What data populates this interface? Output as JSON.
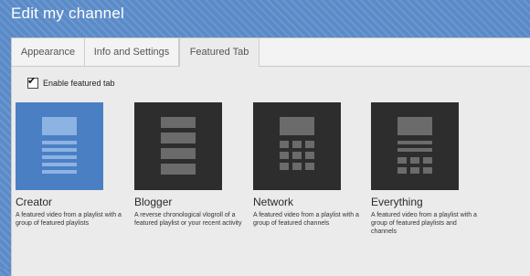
{
  "header": {
    "title": "Edit my channel"
  },
  "tabs": [
    {
      "label": "Appearance"
    },
    {
      "label": "Info and Settings"
    },
    {
      "label": "Featured Tab",
      "selected": true
    }
  ],
  "enable_featured": {
    "label": "Enable featured tab",
    "checked": true
  },
  "layouts": [
    {
      "name": "Creator",
      "description": "A featured video from a playlist with a group of featured playlists",
      "selected": true
    },
    {
      "name": "Blogger",
      "description": "A reverse chronological vlogroll of a featured playlist or your recent activity",
      "selected": false
    },
    {
      "name": "Network",
      "description": "A featured video from a playlist with a group of featured channels",
      "selected": false
    },
    {
      "name": "Everything",
      "description": "A featured video from a playlist with a group of featured playlists and channels",
      "selected": false
    }
  ],
  "colors": {
    "selected_tile": "#4a7fc4",
    "tile": "#2d2d2d",
    "background": "#5a8bc8"
  }
}
